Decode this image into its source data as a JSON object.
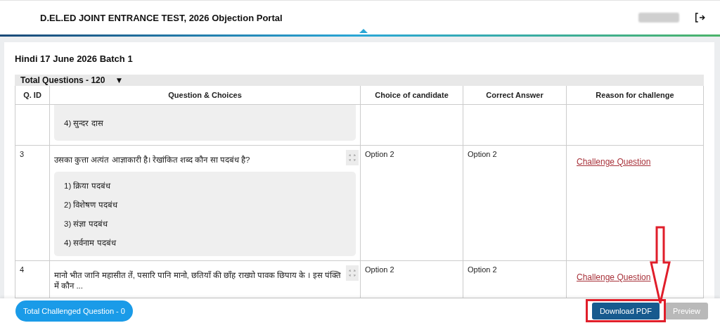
{
  "header": {
    "title": "D.EL.ED JOINT ENTRANCE TEST, 2026 Objection Portal"
  },
  "page": {
    "title": "Hindi 17 June 2026 Batch 1",
    "total_questions": "Total Questions - 120",
    "dropdown_caret": "▼"
  },
  "table": {
    "columns": [
      "Q. ID",
      "Question & Choices",
      "Choice of candidate",
      "Correct Answer",
      "Reason for challenge"
    ],
    "rows": [
      {
        "choices": [
          "4) सुन्दर दास"
        ]
      },
      {
        "id": "3",
        "question": "उसका कुत्ता अत्यंत आज्ञाकारी है। रेखांकित शब्द कौन सा पदबंध है?",
        "choices": [
          "1) क्रिया पदबंध",
          "2) विशेषण पदबंध",
          "3) संज्ञा पदबंध",
          "4) सर्वनाम पदबंध"
        ],
        "candidate": "Option 2",
        "correct": "Option 2",
        "action": "Challenge Question"
      },
      {
        "id": "4",
        "question": "मानो भीत जानि महासीत तें, पसारि पानि मानो, छतियाँ की छाँह राख्यो पावक छिपाय के । इस पंक्ति में कौन ...",
        "candidate": "Option 2",
        "correct": "Option 2",
        "action": "Challenge Question"
      }
    ]
  },
  "footer": {
    "challenged": "Total Challenged Question - 0",
    "buttons": [
      {
        "label": "Download PDF",
        "disabled": false
      },
      {
        "label": "Preview",
        "disabled": true
      }
    ]
  }
}
